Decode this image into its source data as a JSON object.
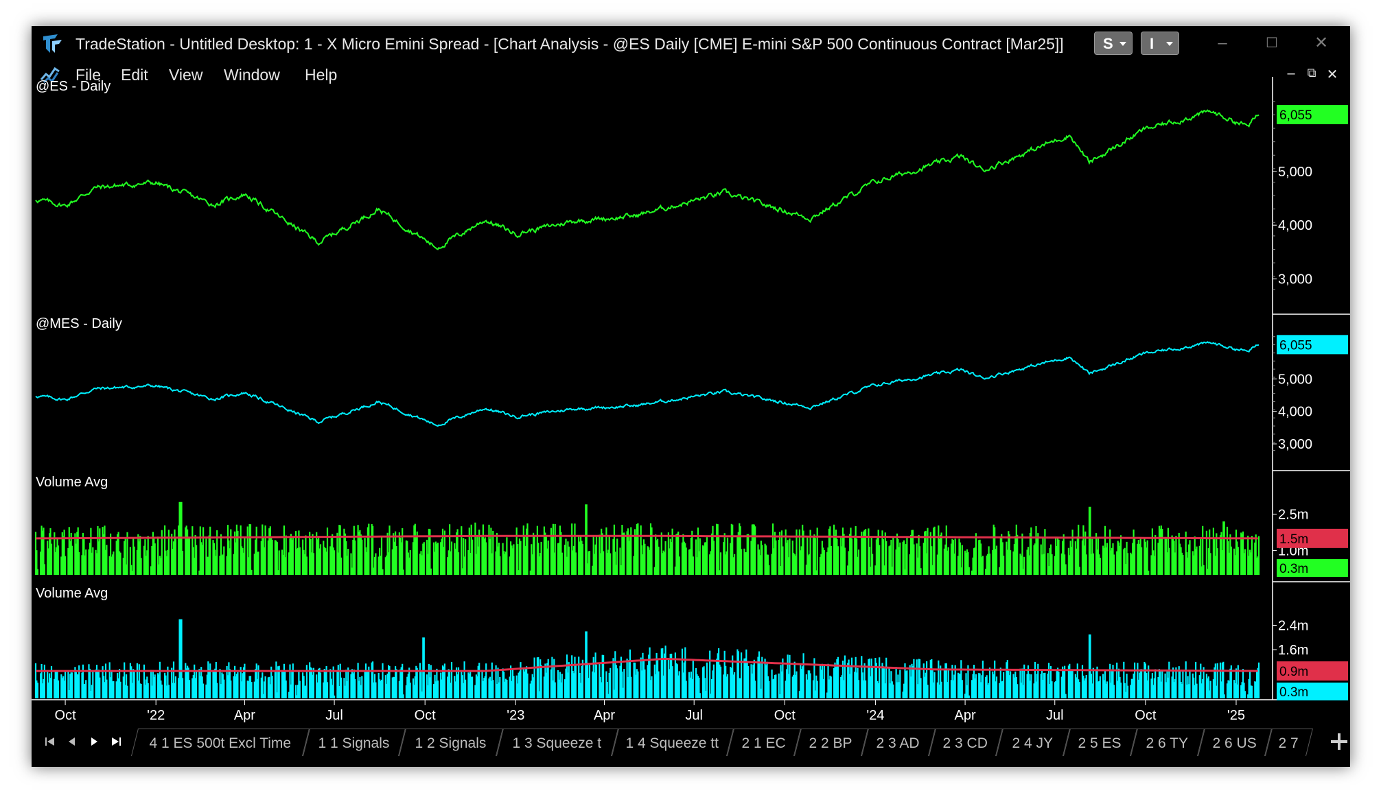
{
  "window": {
    "app_name": "TradeStation",
    "title": "TradeStation  - Untitled Desktop: 1 - X Micro Emini Spread - [Chart Analysis - @ES Daily [CME] E-mini S&P 500 Continuous Contract [Mar25]]",
    "s_button": "S",
    "i_button": "I",
    "controls": [
      "minimize",
      "maximize",
      "close"
    ]
  },
  "menu": {
    "items": [
      "File",
      "Edit",
      "View",
      "Window",
      "Help"
    ],
    "mdi_controls": [
      "minimize",
      "restore",
      "close"
    ]
  },
  "chart_data": [
    {
      "type": "line",
      "title": "@ES - Daily",
      "color": "#22ff22",
      "last_value_label": "6,055",
      "y_ticks": [
        "6,055",
        "5,000",
        "4,000",
        "3,000"
      ],
      "ylim": [
        2600,
        6400
      ],
      "x": [
        "2021-09-01",
        "2021-10-01",
        "2021-11-01",
        "2022-01-01",
        "2022-03-01",
        "2022-04-01",
        "2022-06-15",
        "2022-08-15",
        "2022-10-13",
        "2022-12-01",
        "2023-01-01",
        "2023-03-01",
        "2023-05-01",
        "2023-07-31",
        "2023-10-27",
        "2023-12-31",
        "2024-03-28",
        "2024-04-19",
        "2024-07-16",
        "2024-08-05",
        "2024-09-30",
        "2024-12-06",
        "2025-01-13",
        "2025-01-24"
      ],
      "values": [
        4480,
        4360,
        4700,
        4790,
        4380,
        4580,
        3680,
        4300,
        3580,
        4100,
        3840,
        4080,
        4170,
        4600,
        4130,
        4800,
        5280,
        5020,
        5680,
        5160,
        5780,
        6110,
        5840,
        6055
      ]
    },
    {
      "type": "line",
      "title": "@MES - Daily",
      "color": "#00f0ff",
      "last_value_label": "6,055",
      "y_ticks": [
        "6,055",
        "5,000",
        "4,000",
        "3,000"
      ],
      "ylim": [
        2600,
        6400
      ],
      "x": [
        "2021-09-01",
        "2021-10-01",
        "2021-11-01",
        "2022-01-01",
        "2022-03-01",
        "2022-04-01",
        "2022-06-15",
        "2022-08-15",
        "2022-10-13",
        "2022-12-01",
        "2023-01-01",
        "2023-03-01",
        "2023-05-01",
        "2023-07-31",
        "2023-10-27",
        "2023-12-31",
        "2024-03-28",
        "2024-04-19",
        "2024-07-16",
        "2024-08-05",
        "2024-09-30",
        "2024-12-06",
        "2025-01-13",
        "2025-01-24"
      ],
      "values": [
        4480,
        4360,
        4700,
        4790,
        4380,
        4580,
        3680,
        4300,
        3580,
        4100,
        3840,
        4080,
        4170,
        4600,
        4130,
        4800,
        5280,
        5020,
        5680,
        5160,
        5780,
        6110,
        5840,
        6055
      ]
    },
    {
      "type": "bar",
      "title": "Volume Avg",
      "color": "#22ff22",
      "avg_color": "#e0304a",
      "avg_label": "1.5m",
      "last_label": "0.3m",
      "y_ticks": [
        "2.5m",
        "1.0m"
      ],
      "ylim": [
        0,
        3.5
      ],
      "avg_x": [
        "2021-09-01",
        "2022-12-01",
        "2023-06-01",
        "2025-01-24"
      ],
      "avg_values": [
        1.5,
        1.6,
        1.6,
        1.5
      ],
      "spikes_x": [
        "2022-01-26",
        "2023-03-13",
        "2024-08-05",
        "2024-12-20"
      ],
      "spikes_values": [
        3.0,
        2.9,
        2.8,
        2.2
      ]
    },
    {
      "type": "bar",
      "title": "Volume Avg",
      "color": "#00f0ff",
      "avg_color": "#e0304a",
      "avg_label": "0.9m",
      "last_label": "0.3m",
      "y_ticks": [
        "2.4m",
        "1.6m"
      ],
      "ylim": [
        0,
        3.2
      ],
      "avg_x": [
        "2021-09-01",
        "2022-12-01",
        "2023-06-01",
        "2024-03-01",
        "2025-01-24"
      ],
      "avg_values": [
        0.9,
        0.9,
        1.3,
        0.95,
        0.9
      ],
      "spikes_x": [
        "2022-01-26",
        "2022-09-30",
        "2023-03-13",
        "2024-08-05"
      ],
      "spikes_values": [
        2.6,
        2.0,
        2.2,
        2.1
      ]
    }
  ],
  "x_axis": {
    "labels": [
      "Oct",
      "'22",
      "Apr",
      "Jul",
      "Oct",
      "'23",
      "Apr",
      "Jul",
      "Oct",
      "'24",
      "Apr",
      "Jul",
      "Oct",
      "'25"
    ],
    "dates": [
      "2021-10-01",
      "2022-01-01",
      "2022-04-01",
      "2022-07-01",
      "2022-10-01",
      "2023-01-01",
      "2023-04-01",
      "2023-07-01",
      "2023-10-01",
      "2024-01-01",
      "2024-04-01",
      "2024-07-01",
      "2024-10-01",
      "2025-01-01"
    ],
    "start": "2021-09-01",
    "end": "2025-01-24"
  },
  "tabs": [
    "4 1 ES 500t Excl Time",
    "1 1 Signals",
    "1 2 Signals",
    "1 3 Squeeze t",
    "1 4 Squeeze tt",
    "2 1 EC",
    "2 2 BP",
    "2 3 AD",
    "2 3 CD",
    "2 4 JY",
    "2 5 ES",
    "2 6 TY",
    "2 6 US",
    "2 7"
  ]
}
